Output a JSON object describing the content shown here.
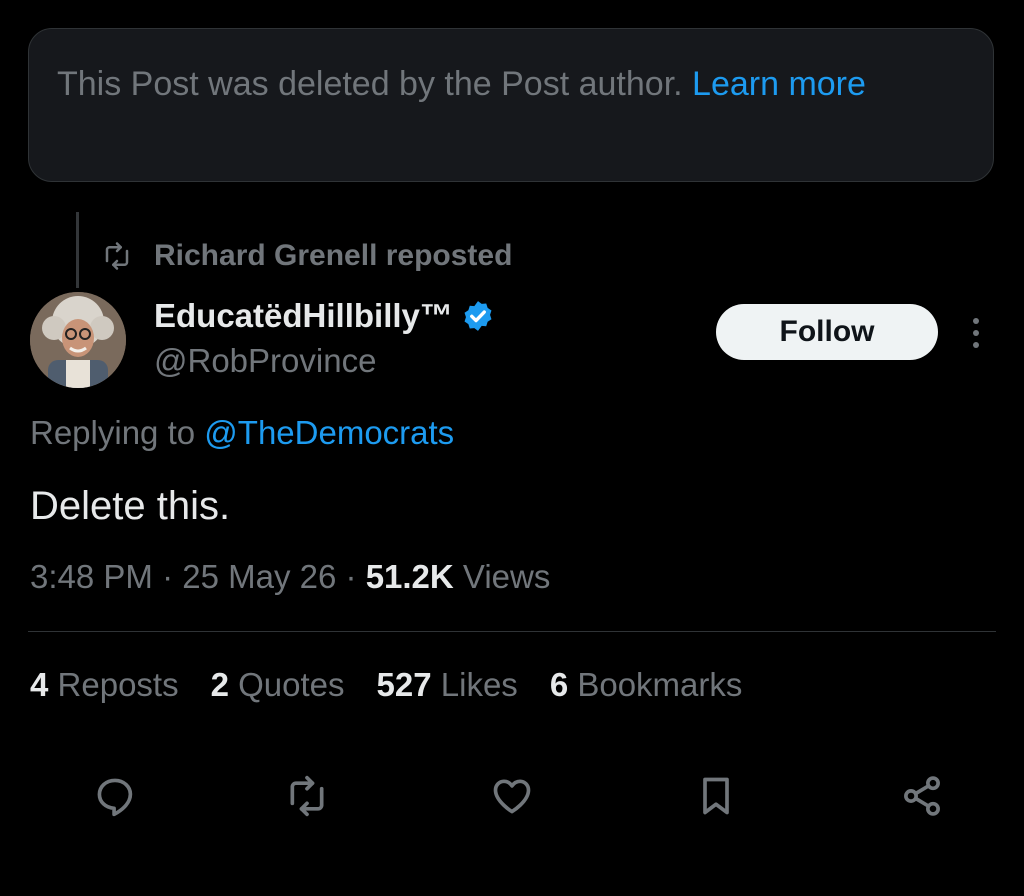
{
  "deleted_notice": {
    "text": "This Post was deleted by the Post author.",
    "link": "Learn more"
  },
  "repost": {
    "text": "Richard Grenell reposted",
    "icon": "repost-icon"
  },
  "author": {
    "display_name": "EducatëdHillbilly™",
    "handle": "@RobProvince",
    "verified_icon": "verified-badge-icon",
    "verified_color": "#1d9bf0"
  },
  "follow_label": "Follow",
  "reply": {
    "prefix": "Replying to",
    "mention": "@TheDemocrats"
  },
  "post": {
    "text": "Delete this.",
    "time": "3:48 PM",
    "date": "25 May 26",
    "views_count": "51.2K",
    "views_label": "Views"
  },
  "stats": [
    {
      "count": "4",
      "label": "Reposts"
    },
    {
      "count": "2",
      "label": "Quotes"
    },
    {
      "count": "527",
      "label": "Likes"
    },
    {
      "count": "6",
      "label": "Bookmarks"
    }
  ],
  "actions": [
    "reply-icon",
    "repost-icon",
    "like-icon",
    "bookmark-icon",
    "share-icon"
  ],
  "colors": {
    "background": "#000000",
    "accent": "#1d9bf0",
    "muted_text": "#71767b",
    "primary_text": "#e7e9ea"
  }
}
